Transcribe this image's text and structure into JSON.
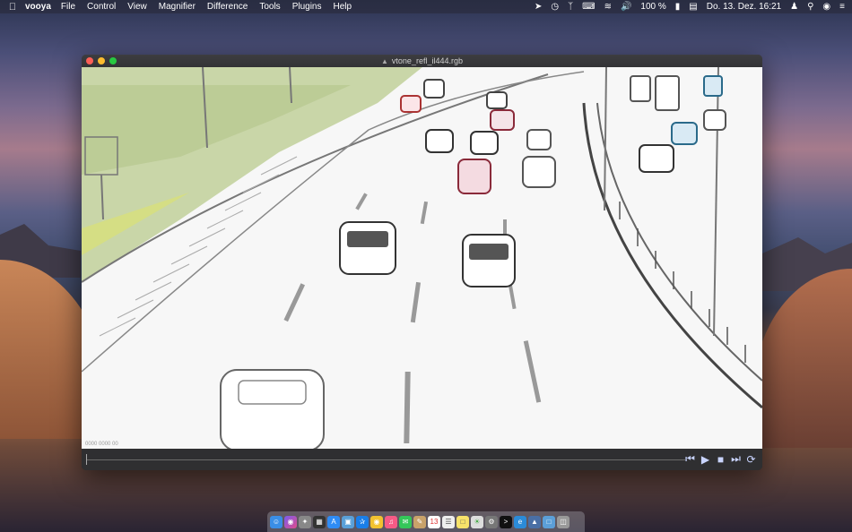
{
  "menubar": {
    "app_name": "vooya",
    "menus": [
      "File",
      "Control",
      "View",
      "Magnifier",
      "Difference",
      "Tools",
      "Plugins",
      "Help"
    ],
    "battery": "100 %",
    "datetime": "Do. 13. Dez.  16:21"
  },
  "window": {
    "title": "vtone_refl_il444.rgb",
    "coord_readout": "0000 0000 00"
  },
  "dock": {
    "icons": [
      "finder-icon",
      "siri-icon",
      "launchpad-icon",
      "grid-icon",
      "appstore-icon",
      "preview-icon",
      "safari-icon",
      "chrome-icon",
      "music-icon",
      "messages-icon",
      "notes-icon",
      "calendar-icon",
      "textedit-icon",
      "stickies-icon",
      "photos-icon",
      "system-prefs-icon",
      "terminal-icon",
      "edge-icon",
      "vooya-icon",
      "folder-icon",
      "trash-icon"
    ]
  }
}
